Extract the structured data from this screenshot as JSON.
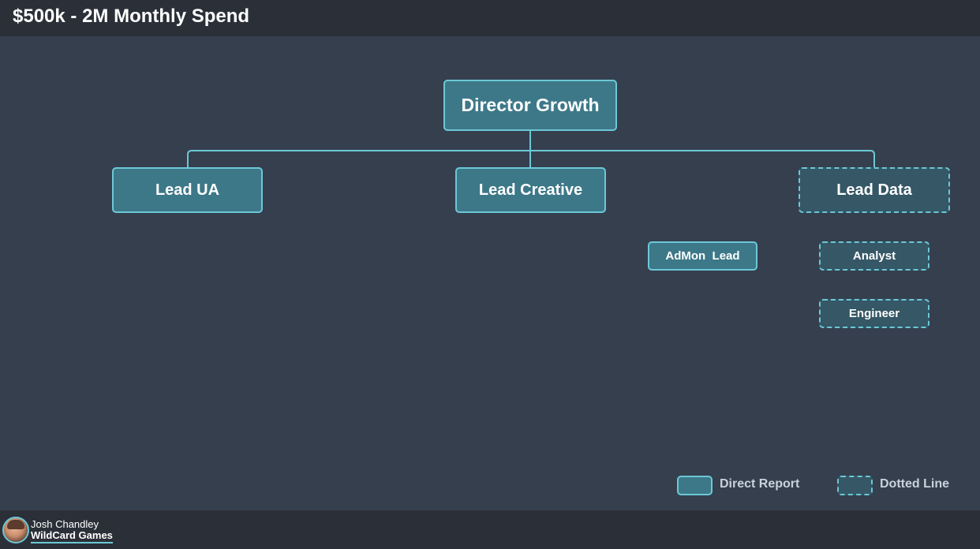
{
  "title": "$500k - 2M Monthly Spend",
  "colors": {
    "background": "#353f4e",
    "bars": "#2b3038",
    "node_fill": "#3d7888",
    "node_fill_dotted": "#355766",
    "node_border": "#6cc8d6",
    "text": "#ffffff"
  },
  "nodes": {
    "director": {
      "label": "Director Growth",
      "style": "solid"
    },
    "lead_ua": {
      "label": "Lead UA",
      "style": "solid"
    },
    "lead_creative": {
      "label": "Lead Creative",
      "style": "solid"
    },
    "lead_data": {
      "label": "Lead Data",
      "style": "dotted"
    },
    "admon_lead": {
      "label": "AdMon  Lead",
      "style": "solid"
    },
    "analyst": {
      "label": "Analyst",
      "style": "dotted"
    },
    "engineer": {
      "label": "Engineer",
      "style": "dotted"
    }
  },
  "edges": [
    {
      "from": "Director Growth",
      "to": "Lead UA"
    },
    {
      "from": "Director Growth",
      "to": "Lead Creative"
    },
    {
      "from": "Director Growth",
      "to": "Lead Data"
    }
  ],
  "legend": {
    "direct": "Direct Report",
    "dotted": "Dotted Line"
  },
  "footer": {
    "author": "Josh Chandley",
    "company": "WildCard Games",
    "avatar_icon": "author-avatar"
  }
}
